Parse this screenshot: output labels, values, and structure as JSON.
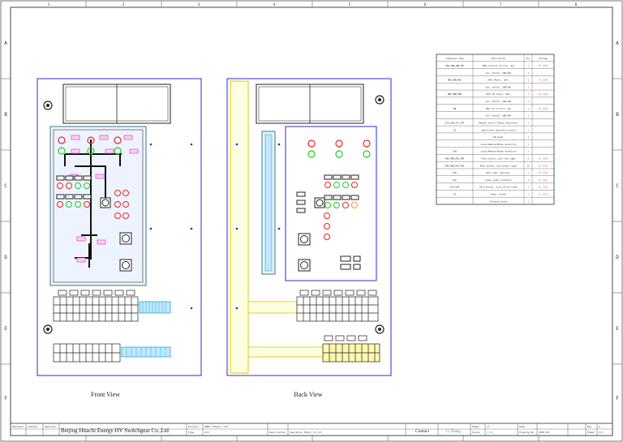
{
  "frame": {
    "col_numbers": [
      "1",
      "2",
      "3",
      "4",
      "5",
      "6",
      "7",
      "8"
    ],
    "row_letters": [
      "A",
      "B",
      "C",
      "D",
      "E",
      "F"
    ]
  },
  "views": {
    "front": "Front View",
    "back": "Back View"
  },
  "component_table": {
    "headers": [
      "Component name",
      "Description",
      "Qty",
      "Voltage"
    ],
    "rows": [
      [
        "MBA,MBB,MBC,MB",
        "MCB (Control Circuit, 6A)",
        "1",
        "DC 110V"
      ],
      [
        "",
        "Aux. Switch, 1NO+1NC",
        "1",
        ""
      ],
      [
        "MBA,MBB,MBC",
        "MCB (Motor, 10A)",
        "1",
        "AC 230V"
      ],
      [
        "",
        "Aux. Switch, 1NO+1NC",
        "1",
        ""
      ],
      [
        "MBA,MBB,MBP",
        "MCB (DC motor, 16A)",
        "1",
        "DC 110V"
      ],
      [
        "",
        "Aux. Switch, 1NO+1NC",
        "1",
        ""
      ],
      [
        "MB",
        "MCB (AC Circuit, 6A)",
        "1",
        "AC 230V"
      ],
      [
        "",
        "Aux. Switch, 1NO+1NC",
        "1",
        ""
      ],
      [
        "SFA,SFB,SFC,SFM",
        "Remote switch (Phase selection)",
        "1",
        ""
      ],
      [
        "SS",
        "Open/Close operation switch",
        "1",
        ""
      ],
      [
        "",
        "PD panel",
        "1",
        ""
      ],
      [
        "",
        "Local/Remote/Phase selection",
        "1",
        ""
      ],
      [
        "SSM",
        "Local/Remote/Phase selection",
        "1",
        ""
      ],
      [
        "PBA,PBB,PBC,PBO",
        "Push button, with red light",
        "3",
        "DC 110V"
      ],
      [
        "PBA,PBB,PBC,PBO",
        "Push button, with green light",
        "12",
        "DC 110V"
      ],
      [
        "HLR",
        "Red light indicator",
        "1",
        "DC 110V"
      ],
      [
        "HLG",
        "Green light indicator",
        "1",
        "DC 110V"
      ],
      [
        "HLA,HLB",
        "Push button, with yellow light",
        "1",
        "DC 110V"
      ],
      [
        "XS",
        "Power socket",
        "1",
        "AC 230V"
      ],
      [
        "",
        "Terminal marks",
        "1",
        ""
      ]
    ]
  },
  "title_block": {
    "roles": [
      "Designer",
      "Checker",
      "Approver"
    ],
    "company": "Beijing Hitachi Energy HV Switchgear Co.,Ltd",
    "project_label": "Project",
    "type_label": "Type",
    "project_value": "ZN63 (Power) LCP",
    "type_value": "LCP",
    "description_label": "Description",
    "description_value": "Operation Panel of LCC",
    "contact_label": "Contact",
    "contact_value": "Li Xiang",
    "right_labels": [
      "Paper",
      "Scale",
      "Date",
      "Drawing No.",
      "Rev",
      "Sheet"
    ],
    "right_values": [
      "A3",
      "1:10",
      "2023.09",
      "",
      "A",
      "1/1"
    ]
  }
}
